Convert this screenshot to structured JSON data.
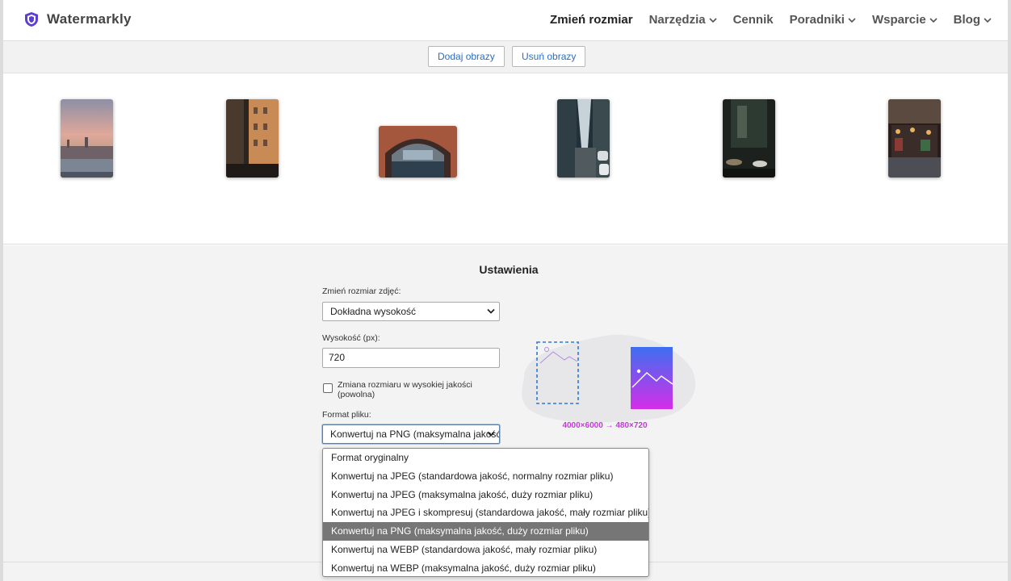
{
  "header": {
    "logo_text": "Watermarkly",
    "nav": [
      {
        "label": "Zmień rozmiar",
        "active": true,
        "has_dropdown": false
      },
      {
        "label": "Narzędzia",
        "has_dropdown": true
      },
      {
        "label": "Cennik",
        "has_dropdown": false
      },
      {
        "label": "Poradniki",
        "has_dropdown": true
      },
      {
        "label": "Wsparcie",
        "has_dropdown": true
      },
      {
        "label": "Blog",
        "has_dropdown": true
      }
    ]
  },
  "toolbar": {
    "add_images_label": "Dodaj obrazy",
    "remove_images_label": "Usuń obrazy"
  },
  "gallery": {
    "thumbnails": [
      {
        "name": "thumb-city-sunset",
        "subject": "city skyline at sunset"
      },
      {
        "name": "thumb-street-buildings",
        "subject": "street with buildings"
      },
      {
        "name": "thumb-canal-arch",
        "subject": "canal under arch"
      },
      {
        "name": "thumb-street-cars",
        "subject": "street with parked cars"
      },
      {
        "name": "thumb-cafe-terrace",
        "subject": "cafe terrace"
      },
      {
        "name": "thumb-shop-front",
        "subject": "shop front at night"
      }
    ]
  },
  "settings": {
    "title": "Ustawienia",
    "resize_label": "Zmień rozmiar zdjęć:",
    "resize_value": "Dokładna wysokość",
    "height_label": "Wysokość (px):",
    "height_value": "720",
    "hq_label": "Zmiana rozmiaru w wysokiej jakości (powolna)",
    "hq_checked": false,
    "format_label": "Format pliku:",
    "format_value": "Konwertuj na PNG (maksymalna jakość, duży rozmiar pliku)",
    "illustration_caption": "4000×6000 → 480×720",
    "format_options": [
      "Format oryginalny",
      "Konwertuj na JPEG (standardowa jakość, normalny rozmiar pliku)",
      "Konwertuj na JPEG (maksymalna jakość, duży rozmiar pliku)",
      "Konwertuj na JPEG i skompresuj (standardowa jakość, mały rozmiar pliku)",
      "Konwertuj na PNG (maksymalna jakość, duży rozmiar pliku)",
      "Konwertuj na WEBP (standardowa jakość, mały rozmiar pliku)",
      "Konwertuj na WEBP (maksymalna jakość, duży rozmiar pliku)"
    ],
    "selected_option_index": 4
  },
  "colors": {
    "link_blue": "#2a6cc4",
    "accent_purple": "#c03ad8",
    "selected_option_bg": "#767676",
    "logo_purple": "#5a3fd0"
  }
}
